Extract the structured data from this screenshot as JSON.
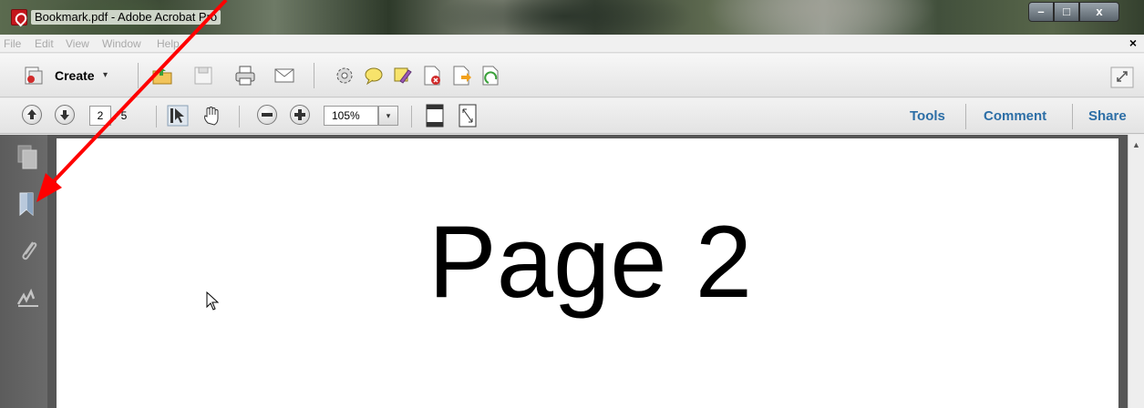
{
  "window": {
    "title": "Bookmark.pdf - Adobe Acrobat Pro",
    "controls": {
      "minimize": "–",
      "maximize": "□",
      "close": "x"
    }
  },
  "menu": {
    "items": [
      "File",
      "Edit",
      "View",
      "Window",
      "Help"
    ],
    "close": "×"
  },
  "toolbar_primary": {
    "create_label": "Create",
    "create_arrow": "▾",
    "icons": [
      "create-pdf-icon",
      "open-folder-icon",
      "save-icon",
      "print-icon",
      "email-icon",
      "settings-gear-icon",
      "comment-bubble-icon",
      "highlight-icon",
      "pdf-delete-icon",
      "pdf-export-icon",
      "pdf-export-green-icon",
      "expand-window-icon"
    ]
  },
  "toolbar_nav": {
    "current_page": "2",
    "page_total": "/ 5",
    "zoom": "105%",
    "zoom_arrow": "▾",
    "right_links": [
      "Tools",
      "Comment",
      "Share"
    ]
  },
  "left_panel": {
    "icons": [
      "page-thumbnails-icon",
      "bookmarks-icon",
      "attachments-icon",
      "signatures-icon"
    ]
  },
  "document": {
    "page_text": "Page 2"
  },
  "annotation": {
    "color": "#ff0000",
    "points_to": "bookmarks-icon"
  },
  "colors": {
    "link_blue": "#2c6ea6",
    "nav_pane": "#5c5c5c",
    "arrow_red": "#ff0000"
  }
}
